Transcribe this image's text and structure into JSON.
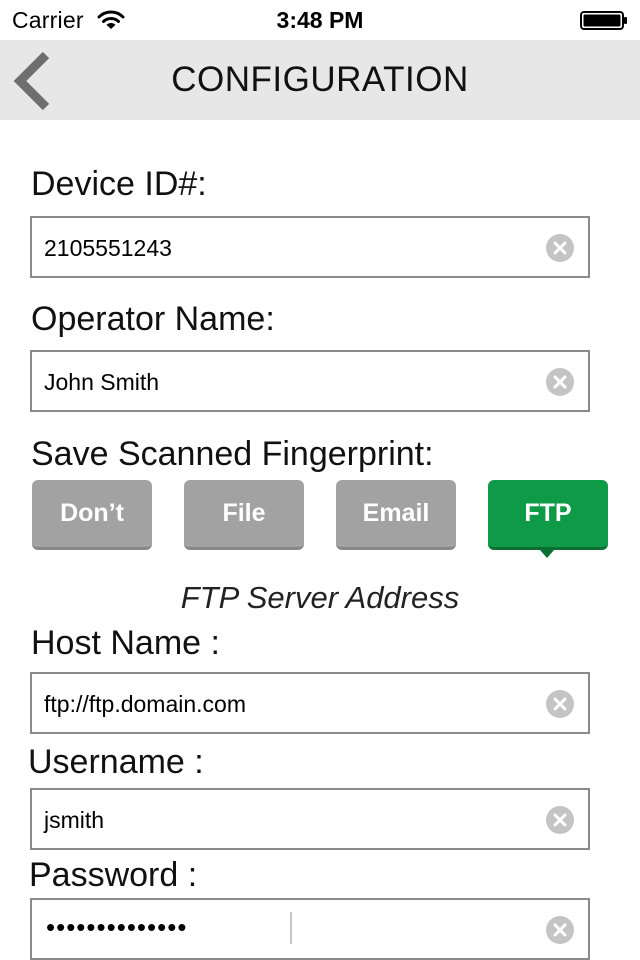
{
  "status_bar": {
    "carrier": "Carrier",
    "time": "3:48 PM",
    "wifi_icon": "wifi-icon",
    "battery_icon": "battery-icon",
    "battery_level": 1.0
  },
  "nav": {
    "title": "CONFIGURATION",
    "back_icon": "chevron-left-icon"
  },
  "form": {
    "device_id": {
      "label": "Device ID#:",
      "value": "2105551243"
    },
    "operator_name": {
      "label": "Operator Name:",
      "value": "John Smith"
    },
    "save_fingerprint": {
      "label": "Save Scanned Fingerprint:",
      "options": [
        "Don’t",
        "File",
        "Email",
        "FTP"
      ],
      "selected": "FTP"
    },
    "ftp_section_title": "FTP Server Address",
    "host_name": {
      "label": "Host Name :",
      "value": "ftp://ftp.domain.com"
    },
    "username": {
      "label": "Username :",
      "value": "jsmith"
    },
    "password": {
      "label": "Password :",
      "value": "••••••••••••••"
    },
    "clear_icon": "clear-icon"
  },
  "colors": {
    "nav_background": "#e7e7e7",
    "option_inactive": "#a2a2a2",
    "option_active": "#0f9a47",
    "field_border": "#8a8a8a"
  }
}
